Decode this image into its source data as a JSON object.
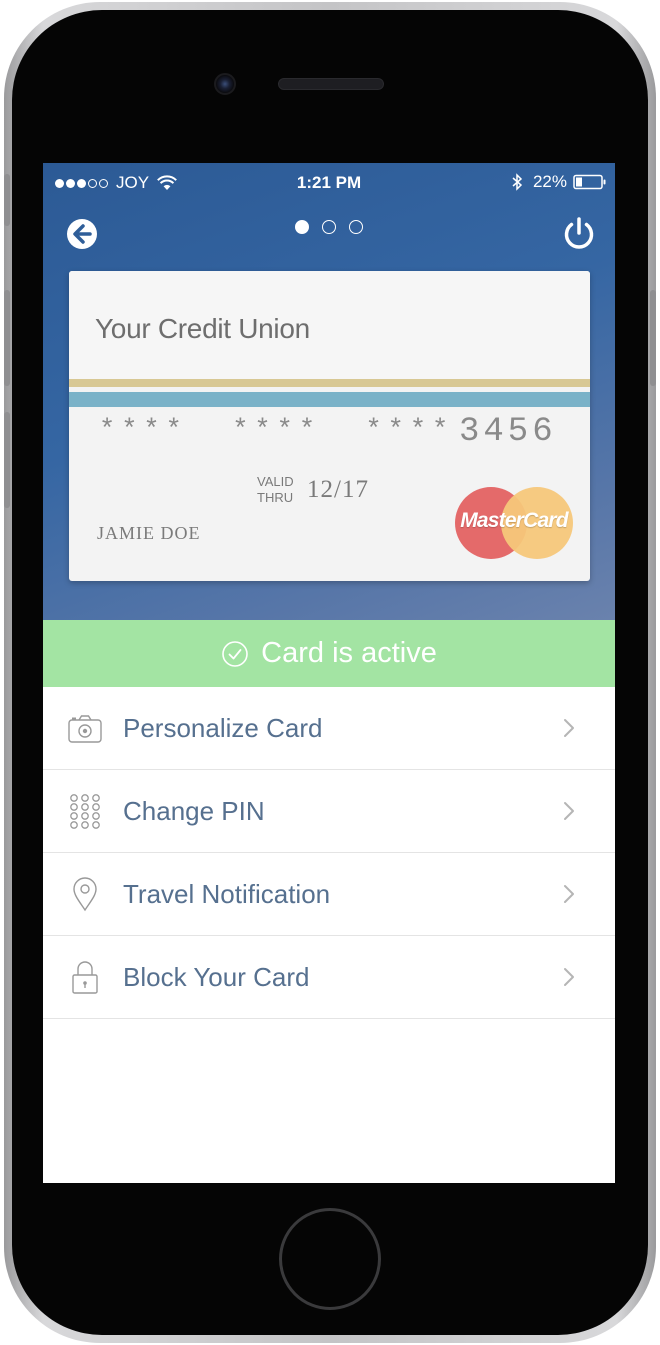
{
  "status_bar": {
    "carrier": "JOY",
    "time": "1:21 PM",
    "battery": "22%",
    "signal_bars": 3,
    "signal_total": 5
  },
  "nav": {
    "back_icon": "back-arrow-circle-icon",
    "power_icon": "power-icon",
    "pages": 3,
    "active_page": 1
  },
  "card": {
    "issuer": "Your Credit Union",
    "masked_groups": [
      "****",
      "****",
      "****"
    ],
    "last4": "3456",
    "valid_line1": "VALID",
    "valid_line2": "THRU",
    "expiry": "12/17",
    "holder": "JAMIE DOE",
    "network": "MasterCard"
  },
  "status_banner": {
    "text": "Card is active",
    "color": "#a3e4a3"
  },
  "menu": {
    "items": [
      {
        "label": "Personalize Card",
        "icon": "camera-icon"
      },
      {
        "label": "Change PIN",
        "icon": "keypad-icon"
      },
      {
        "label": "Travel Notification",
        "icon": "location-pin-icon"
      },
      {
        "label": "Block Your Card",
        "icon": "lock-icon"
      }
    ]
  },
  "colors": {
    "hero_top": "#2c5a95",
    "hero_bottom": "#6a82ad",
    "menu_text": "#56708f",
    "active_green": "#a3e4a3"
  }
}
